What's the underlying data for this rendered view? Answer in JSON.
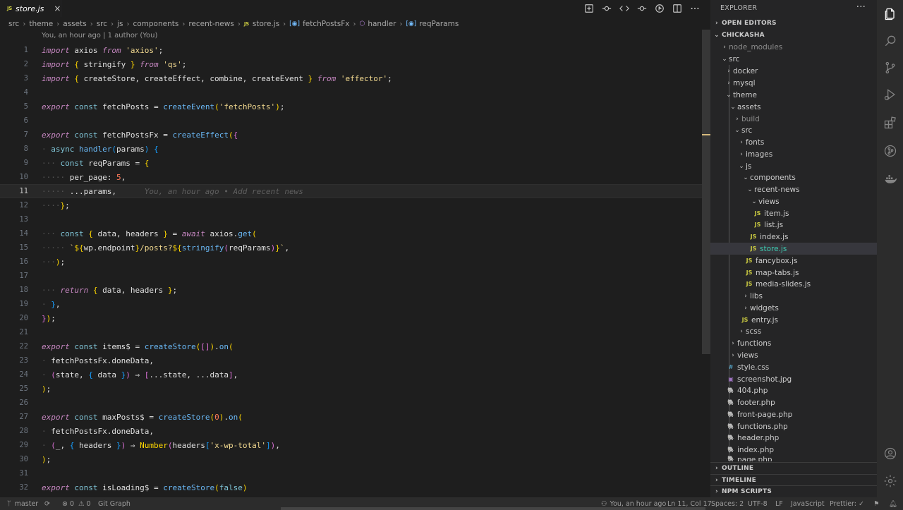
{
  "tab": {
    "badge": "JS",
    "label": "store.js",
    "close": "×"
  },
  "breadcrumb": [
    "src",
    "theme",
    "assets",
    "src",
    "js",
    "components",
    "recent-news",
    "store.js",
    "fetchPostsFx",
    "handler",
    "reqParams"
  ],
  "blame_header": "You, an hour ago | 1 author (You)",
  "inline_blame": "You, an hour ago • Add recent news",
  "line_numbers": [
    "1",
    "2",
    "3",
    "4",
    "5",
    "6",
    "7",
    "8",
    "9",
    "10",
    "11",
    "12",
    "13",
    "14",
    "15",
    "16",
    "17",
    "18",
    "19",
    "20",
    "21",
    "22",
    "23",
    "24",
    "25",
    "26",
    "27",
    "28",
    "29",
    "30",
    "31",
    "32"
  ],
  "explorer": {
    "title": "EXPLORER",
    "more": "···",
    "open_editors": "OPEN EDITORS",
    "project": "CHICKASHA",
    "tree": [
      "node_modules",
      "src",
      "docker",
      "mysql",
      "theme",
      "assets",
      "build",
      "src",
      "fonts",
      "images",
      "js",
      "components",
      "recent-news",
      "views",
      "item.js",
      "list.js",
      "index.js",
      "store.js",
      "fancybox.js",
      "map-tabs.js",
      "media-slides.js",
      "libs",
      "widgets",
      "entry.js",
      "scss",
      "functions",
      "views",
      "style.css",
      "screenshot.jpg",
      "404.php",
      "footer.php",
      "front-page.php",
      "functions.php",
      "header.php",
      "index.php",
      "page.php"
    ],
    "outline": "OUTLINE",
    "timeline": "TIMELINE",
    "npm_scripts": "NPM SCRIPTS"
  },
  "status": {
    "branch": "master",
    "problems": "0",
    "warnings": "0",
    "git_graph": "Git Graph",
    "blame": "You, an hour ago",
    "position": "Ln 11, Col 17",
    "spaces": "Spaces: 2",
    "encoding": "UTF-8",
    "eol": "LF",
    "language": "JavaScript",
    "formatter": "Prettier: ✓"
  },
  "icons": {
    "files": "files-icon",
    "search": "search-icon",
    "scm": "source-control-icon",
    "run": "run-debug-icon",
    "extensions": "extensions-icon",
    "git-graph": "git-graph-icon",
    "docker": "docker-icon",
    "account": "account-icon",
    "settings": "gear-icon"
  },
  "colors": {
    "accent_selected_file": "#3dc9b0",
    "keyword": "#c586c0",
    "string": "#f1d88f",
    "function": "#69b7f4"
  }
}
